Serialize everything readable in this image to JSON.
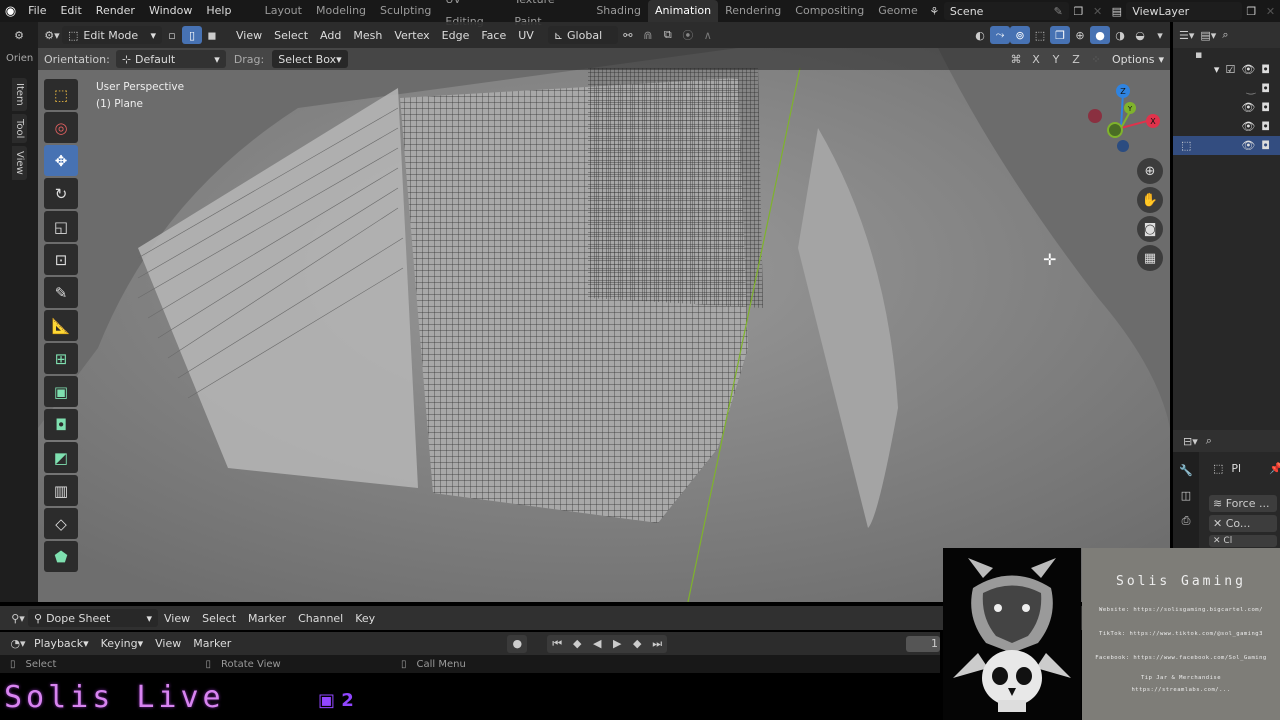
{
  "app": {
    "name": "Blender"
  },
  "topbar": {
    "menus": [
      "File",
      "Edit",
      "Render",
      "Window",
      "Help"
    ],
    "workspaces": [
      "Layout",
      "Modeling",
      "Sculpting",
      "UV Editing",
      "Texture Paint",
      "Shading",
      "Animation",
      "Rendering",
      "Compositing",
      "Geome"
    ],
    "active_workspace": "Animation",
    "scene": "Scene",
    "view_layer": "ViewLayer"
  },
  "viewport_header": {
    "mode": "Edit Mode",
    "menus": [
      "View",
      "Select",
      "Add",
      "Mesh",
      "Vertex",
      "Edge",
      "Face",
      "UV"
    ],
    "transform_orientation": "Global",
    "select_mode_active": "edge"
  },
  "tool_header": {
    "orien_truncated": "Orien",
    "orientation_label": "Orientation:",
    "orientation_value": "Default",
    "drag_label": "Drag:",
    "drag_value": "Select Box",
    "axes": [
      "X",
      "Y",
      "Z"
    ],
    "options_label": "Options"
  },
  "side_tabs": [
    "Item",
    "Tool",
    "View"
  ],
  "viewport": {
    "perspective_label": "User Perspective",
    "object_label": "(1) Plane"
  },
  "tools": [
    {
      "name": "select-box",
      "glyph": "⬚"
    },
    {
      "name": "cursor",
      "glyph": "◎"
    },
    {
      "name": "move",
      "glyph": "✥",
      "active": true
    },
    {
      "name": "rotate",
      "glyph": "↻"
    },
    {
      "name": "scale",
      "glyph": "◱"
    },
    {
      "name": "transform",
      "glyph": "⊡"
    },
    {
      "name": "annotate",
      "glyph": "✎"
    },
    {
      "name": "measure",
      "glyph": "📐"
    },
    {
      "name": "add-cube",
      "glyph": "⊞"
    },
    {
      "name": "extrude",
      "glyph": "▣"
    },
    {
      "name": "inset",
      "glyph": "◘"
    },
    {
      "name": "bevel",
      "glyph": "◩"
    },
    {
      "name": "loop-cut",
      "glyph": "▥"
    },
    {
      "name": "knife",
      "glyph": "◇"
    },
    {
      "name": "poly-build",
      "glyph": "⬟"
    }
  ],
  "gizmo": {
    "x": "X",
    "y": "Y",
    "z": "Z",
    "colors": {
      "x": "#e0324b",
      "y": "#7fb32c",
      "z": "#2f83e0"
    }
  },
  "properties": {
    "object_name_truncated": "Pl",
    "modifiers": [
      "Force ...",
      "Co...",
      "Cl"
    ]
  },
  "dope_sheet": {
    "editor": "Dope Sheet",
    "menus": [
      "View",
      "Select",
      "Marker",
      "Channel",
      "Key"
    ]
  },
  "timeline": {
    "menus": [
      "Playback",
      "Keying",
      "View",
      "Marker"
    ],
    "current_frame": "1"
  },
  "statusbar": {
    "items": [
      "Select",
      "Rotate View",
      "Call Menu"
    ]
  },
  "stream_overlay": {
    "title": "Solis Live",
    "twitch_count": "2",
    "card_title": "Solis Gaming",
    "card_lines": [
      "Website: https://solisgaming.bigcartel.com/",
      "TikTok: https://www.tiktok.com/@sol_gaming3",
      "Facebook: https://www.facebook.com/Sol_Gaming",
      "Tip Jar & Merchandise",
      "https://streamlabs.com/..."
    ]
  },
  "colors": {
    "accent": "#4772b3",
    "header": "#303030",
    "panel": "#282828",
    "overlay_title": "#d884f0",
    "twitch": "#9146ff"
  }
}
